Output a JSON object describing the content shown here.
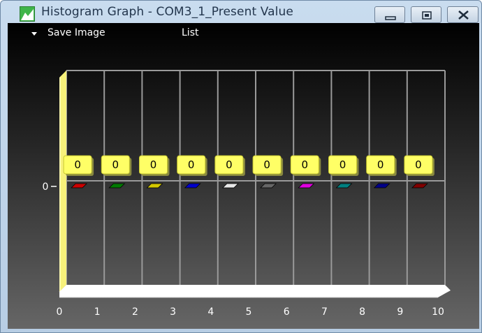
{
  "window": {
    "title": "Histogram Graph - COM3_1_Present Value",
    "icon": "histogram-app-icon",
    "controls": [
      "minimize-icon",
      "restore-icon",
      "close-icon"
    ]
  },
  "menu": {
    "save_image": "Save Image",
    "list": "List"
  },
  "chart_data": {
    "type": "bar",
    "categories": [
      "0",
      "1",
      "2",
      "3",
      "4",
      "5",
      "6",
      "7",
      "8",
      "9"
    ],
    "values": [
      0,
      0,
      0,
      0,
      0,
      0,
      0,
      0,
      0,
      0
    ],
    "value_labels": [
      "0",
      "0",
      "0",
      "0",
      "0",
      "0",
      "0",
      "0",
      "0",
      "0"
    ],
    "bar_colors": [
      "#cc0000",
      "#007a00",
      "#d4c800",
      "#0000cc",
      "#e8e8e8",
      "#666666",
      "#e000e0",
      "#008080",
      "#000088",
      "#800000"
    ],
    "x_ticks": [
      "0",
      "1",
      "2",
      "3",
      "4",
      "5",
      "6",
      "7",
      "8",
      "9",
      "10"
    ],
    "y_ticks": [
      "0"
    ],
    "grid": true,
    "style": "3d"
  }
}
